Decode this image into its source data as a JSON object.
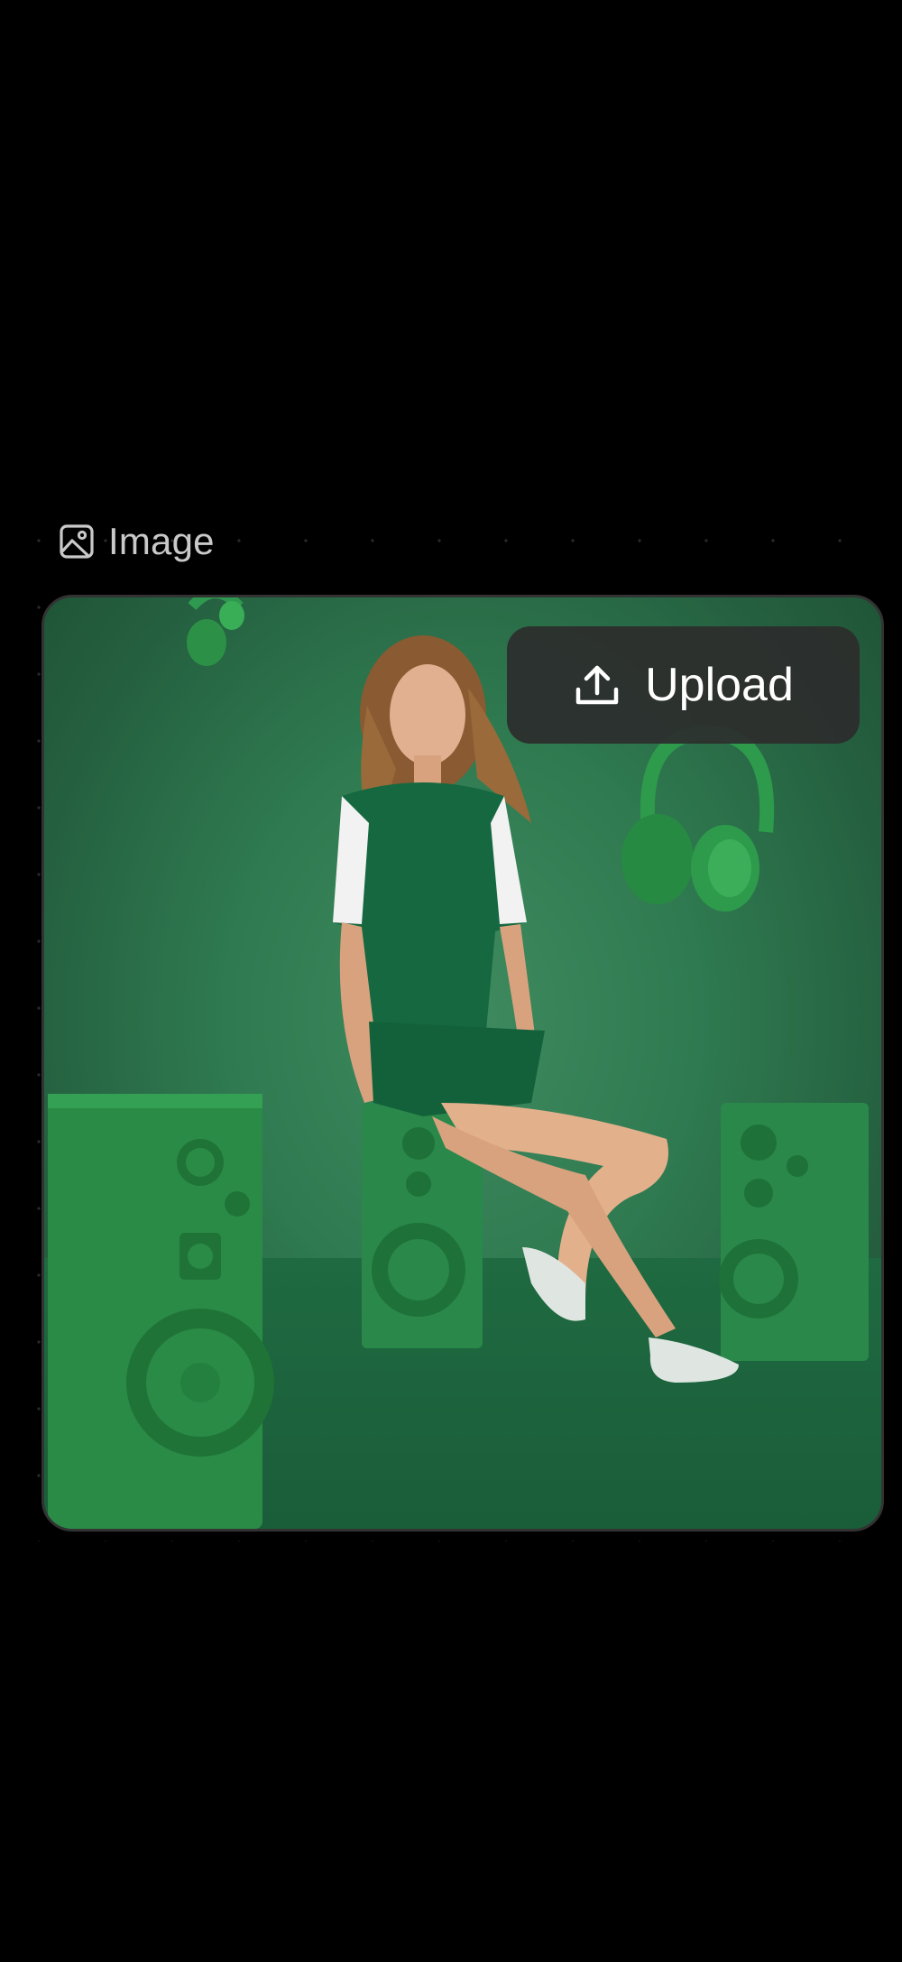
{
  "node": {
    "icon": "image-icon",
    "title": "Image"
  },
  "image_card": {
    "scene": "photo",
    "upload_button": {
      "icon": "upload-icon",
      "label": "Upload"
    }
  },
  "colors": {
    "background": "#000000",
    "title_text": "#c9c9c9",
    "button_bg": "#2c2c2c",
    "button_text": "#ffffff"
  }
}
